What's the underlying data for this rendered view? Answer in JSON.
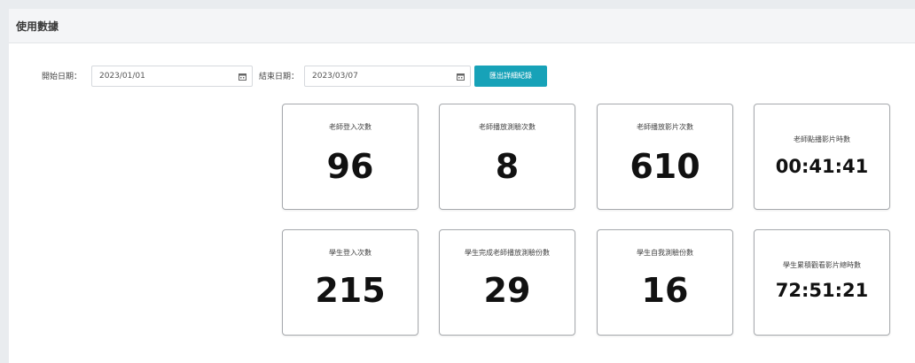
{
  "page": {
    "title": "使用數據"
  },
  "filters": {
    "start_label": "開始日期：",
    "start_value": "2023/01/01",
    "end_label": "結束日期：",
    "end_value": "2023/03/07",
    "export_label": "匯出詳細紀錄"
  },
  "stats": {
    "teacher_logins": {
      "label": "老師登入次數",
      "value": "96"
    },
    "teacher_tests": {
      "label": "老師播放測驗次數",
      "value": "8"
    },
    "teacher_videos": {
      "label": "老師播放影片次數",
      "value": "610"
    },
    "teacher_video_time": {
      "label": "老師點播影片時數",
      "value": "00:41:41"
    },
    "student_logins": {
      "label": "學生登入次數",
      "value": "215"
    },
    "student_tests": {
      "label": "學生完成老師播放測驗份數",
      "value": "29"
    },
    "student_self_tests": {
      "label": "學生自我測驗份數",
      "value": "16"
    },
    "student_video_time": {
      "label": "學生累積觀看影片總時數",
      "value": "72:51:21"
    }
  },
  "colors": {
    "accent": "#17a2b8",
    "card_border": "#a6a9ad",
    "header_bg": "#f4f5f7"
  }
}
